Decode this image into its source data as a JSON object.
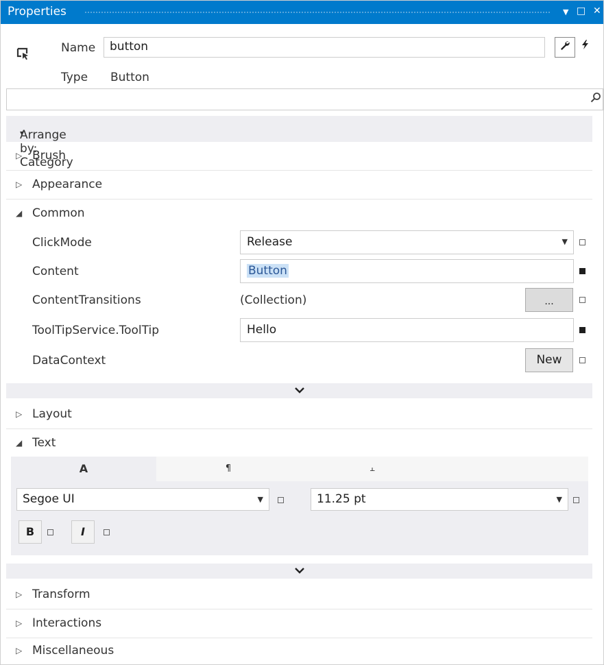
{
  "window": {
    "title": "Properties",
    "dropdown_icon": "▼",
    "maximize_icon": "□",
    "close_icon": "✕"
  },
  "header": {
    "element_icon": "cursor-select-icon",
    "name_label": "Name",
    "name_value": "button",
    "type_label": "Type",
    "type_value": "Button",
    "properties_tool": "wrench-icon",
    "events_tool": "lightning-icon"
  },
  "search": {
    "placeholder": "",
    "icon": "search-icon"
  },
  "arrange": {
    "label": "Arrange by: Category",
    "arrow": "▾"
  },
  "categories": {
    "brush": "Brush",
    "appearance": "Appearance",
    "common": "Common",
    "layout": "Layout",
    "text": "Text",
    "transform": "Transform",
    "interactions": "Interactions",
    "miscellaneous": "Miscellaneous"
  },
  "common_props": [
    {
      "name": "ClickMode",
      "value": "Release",
      "marker": "empty"
    },
    {
      "name": "Content",
      "value": "Button",
      "marker": "filled"
    },
    {
      "name": "ContentTransitions",
      "value": "(Collection)",
      "button": "...",
      "marker": "empty"
    },
    {
      "name": "ToolTipService.ToolTip",
      "value": "Hello",
      "marker": "filled"
    },
    {
      "name": "DataContext",
      "button": "New",
      "marker": "empty"
    }
  ],
  "expand_icon": "⌄",
  "text_panel": {
    "tabs": [
      "A",
      "¶",
      "⫠"
    ],
    "font_family": "Segoe UI",
    "font_size": "11.25 pt",
    "bold_label": "B",
    "italic_label": "I"
  },
  "colors": {
    "accent": "#007acc",
    "band": "#eeeef2",
    "selection": "#cbe1f6"
  }
}
